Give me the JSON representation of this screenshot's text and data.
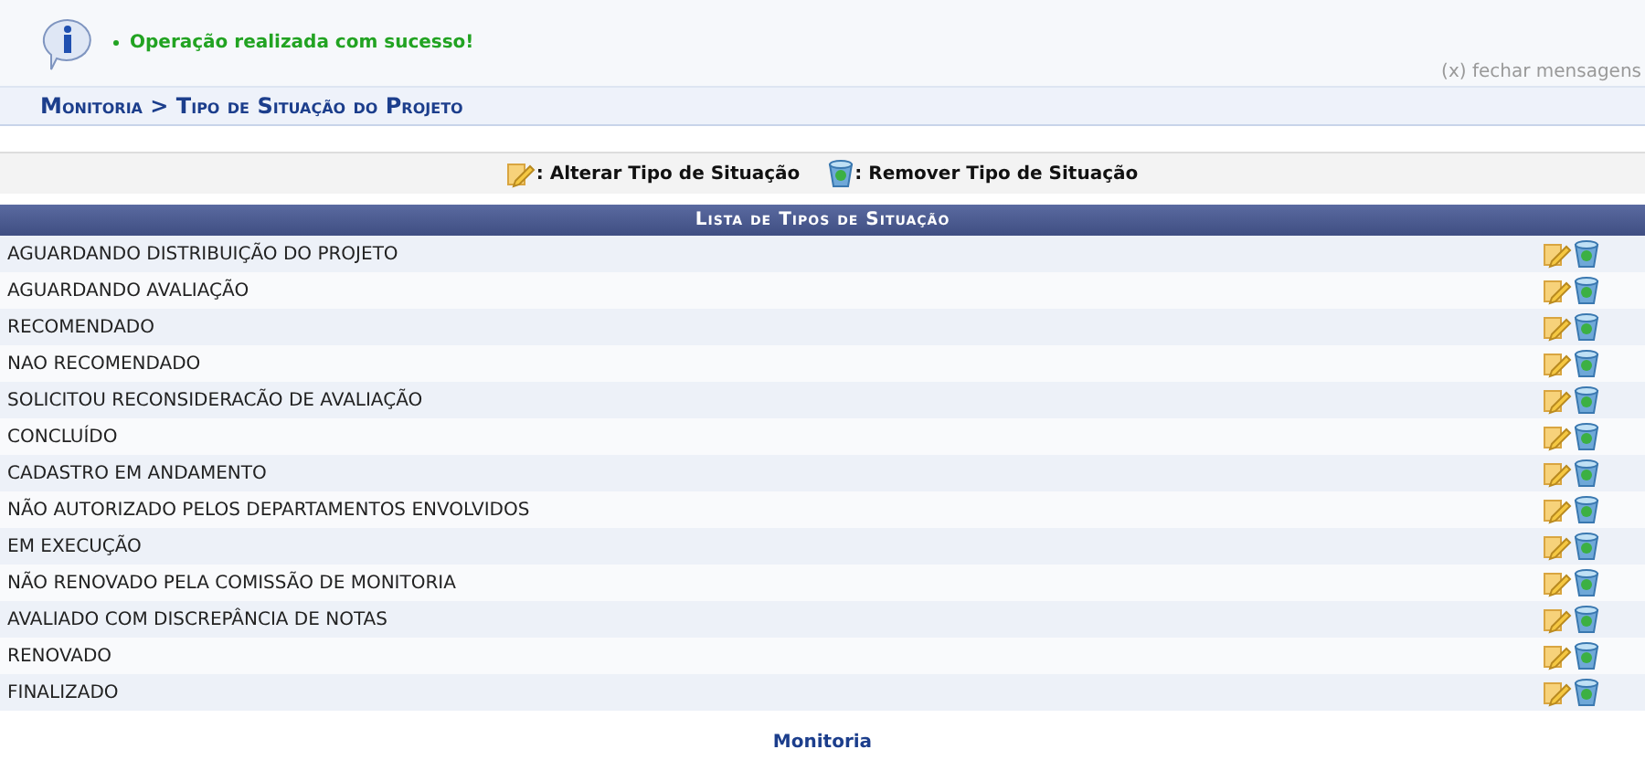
{
  "message": {
    "text": "Operação realizada com sucesso!",
    "close": "(x) fechar mensagens"
  },
  "breadcrumb": "Monitoria > Tipo de Situação do Projeto",
  "legend": [
    {
      "kind": "edit",
      "label": ": Alterar Tipo de Situação"
    },
    {
      "kind": "remove",
      "label": ": Remover Tipo de Situação"
    }
  ],
  "table": {
    "title": "Lista de Tipos de Situação",
    "rows": [
      "AGUARDANDO DISTRIBUIÇÃO DO PROJETO",
      "AGUARDANDO AVALIAÇÃO",
      "RECOMENDADO",
      "NAO RECOMENDADO",
      "SOLICITOU RECONSIDERACÃO DE AVALIAÇÃO",
      "CONCLUÍDO",
      "CADASTRO EM ANDAMENTO",
      "NÃO AUTORIZADO PELOS DEPARTAMENTOS ENVOLVIDOS",
      "EM EXECUÇÃO",
      "NÃO RENOVADO PELA COMISSÃO DE MONITORIA",
      "AVALIADO COM DISCREPÂNCIA DE NOTAS",
      "RENOVADO",
      "FINALIZADO"
    ]
  },
  "footer_link": "Monitoria"
}
